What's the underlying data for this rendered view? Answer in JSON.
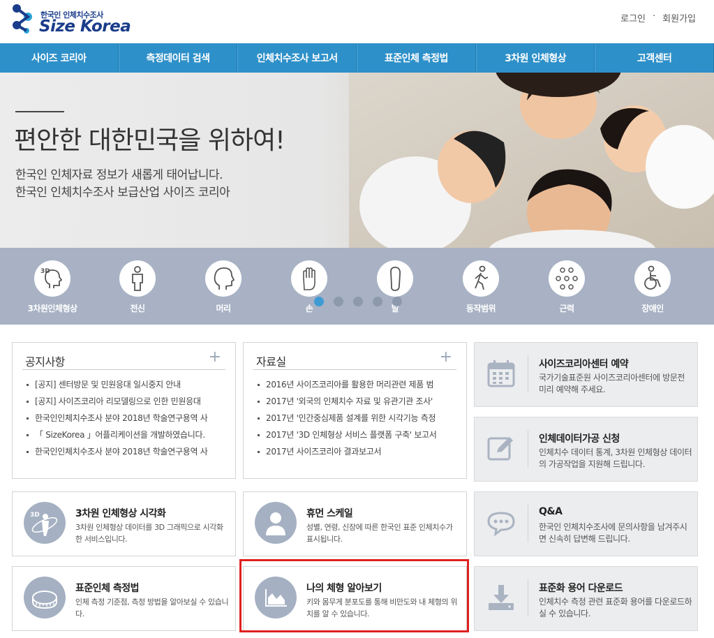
{
  "header": {
    "logo_sub": "한국인 인체치수조사",
    "logo_main": "Size Korea",
    "login": "로그인",
    "separator": "·",
    "join": "회원가입"
  },
  "gnb": [
    "사이즈 코리아",
    "측정데이터 검색",
    "인체치수조사 보고서",
    "표준인체 측정법",
    "3차원 인체형상",
    "고객센터"
  ],
  "hero": {
    "title": "편안한 대한민국을 위하여!",
    "desc1": "한국인 인체자료 정보가 새롭게 태어납니다.",
    "desc2": "한국인 인체치수조사 보급산업 사이즈 코리아"
  },
  "quick": {
    "items": [
      "3차원인체형상",
      "전신",
      "머리",
      "손",
      "발",
      "동작범위",
      "근력",
      "장애인"
    ],
    "icon_3d_text": "3D",
    "active_dot": 0
  },
  "notice": {
    "title": "공지사항",
    "plus": "+",
    "items": [
      "[공지] 센터방문 및 민원응대 일시중지 안내",
      "[공지] 사이즈코리아 리모델링으로 인한 민원응대",
      "한국인인체치수조사 분야 2018년 학술연구용역 사",
      "「 SizeKorea 」어플리케이션을 개발하였습니다.",
      "한국인인체치수조사 분야 2018년 학술연구용역 사"
    ]
  },
  "archive": {
    "title": "자료실",
    "plus": "+",
    "items": [
      "2016년 사이즈코리아를 활용한 머리관련 제품 범",
      "2017년 '외국의 인체치수 자료 및 유관기관 조사'",
      "2017년 '인간중심제품 설계를 위한 시각기능 측정",
      "2017년 '3D 인체형상 서비스 플랫폼 구축' 보고서",
      "2017년 사이즈코리아 결과보고서"
    ]
  },
  "services": {
    "reserve": {
      "title": "사이즈코리아센터 예약",
      "desc": "국가기술표준원 사이즈코리아센터에 방문전 미리 예약해 주세요."
    },
    "process": {
      "title": "인체데이터가공 신청",
      "desc": "인체치수 데이터 통계, 3차원 인체형상 데이터의 가공작업을 지원해 드립니다."
    },
    "qna": {
      "title": "Q&A",
      "desc": "한국인 인체치수조사에 문의사항을 남겨주시면 신속히 답변해 드립니다."
    },
    "download": {
      "title": "표준화 용어 다운로드",
      "desc": "인체치수 측정 관련 표준화 용어를 다운로드하실 수 있습니다."
    }
  },
  "cards": {
    "viz3d": {
      "title": "3차원 인체형상 시각화",
      "desc": "3차원 인체형상 데이터를 3D 그래픽으로 시각화한 서비스입니다.",
      "icon_text": "3D"
    },
    "human": {
      "title": "휴먼 스케일",
      "desc": "성별, 연령, 신장에 따른 한국인 표준 인체치수가 표시됩니다."
    },
    "method": {
      "title": "표준인체 측정법",
      "desc": "인체 측정 기준점, 측정 방법을 알아보실 수 있습니다."
    },
    "mybody": {
      "title": "나의 체형 알아보기",
      "desc": "키와 몸무게 분포도를 통해 비만도와 내 체형의 위치를 알 수 있습니다."
    }
  },
  "colors": {
    "brand": "#1a3c8a",
    "gnb": "#2e90c9",
    "highlight": "#e02020"
  }
}
